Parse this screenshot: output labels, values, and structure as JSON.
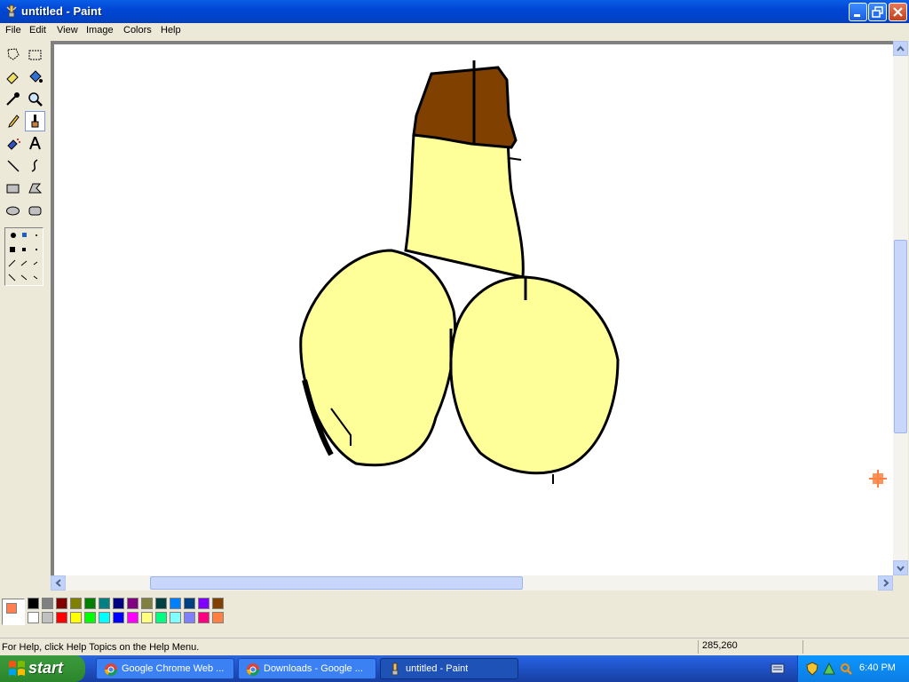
{
  "window": {
    "title": "untitled - Paint"
  },
  "menu": {
    "items": [
      "File",
      "Edit",
      "View",
      "Image",
      "Colors",
      "Help"
    ]
  },
  "toolbox": {
    "tools": [
      {
        "name": "free-form-select-icon"
      },
      {
        "name": "select-icon"
      },
      {
        "name": "eraser-icon"
      },
      {
        "name": "fill-with-color-icon"
      },
      {
        "name": "pick-color-icon"
      },
      {
        "name": "magnifier-icon"
      },
      {
        "name": "pencil-icon"
      },
      {
        "name": "brush-icon",
        "active": true
      },
      {
        "name": "airbrush-icon"
      },
      {
        "name": "text-icon"
      },
      {
        "name": "line-icon"
      },
      {
        "name": "curve-icon"
      },
      {
        "name": "rectangle-icon"
      },
      {
        "name": "polygon-icon"
      },
      {
        "name": "ellipse-icon"
      },
      {
        "name": "rounded-rectangle-icon"
      }
    ]
  },
  "colors": {
    "primary": "#ff7f50",
    "secondary": "#ffffff",
    "palette_row1": [
      "#000000",
      "#808080",
      "#800000",
      "#808000",
      "#008000",
      "#008080",
      "#000080",
      "#800080",
      "#808040",
      "#004040",
      "#0080ff",
      "#004080",
      "#8000ff",
      "#804000"
    ],
    "palette_row2": [
      "#ffffff",
      "#c0c0c0",
      "#ff0000",
      "#ffff00",
      "#00ff00",
      "#00ffff",
      "#0000ff",
      "#ff00ff",
      "#ffff80",
      "#00ff80",
      "#80ffff",
      "#8080ff",
      "#ff0080",
      "#ff8040"
    ]
  },
  "status": {
    "help_text": "For Help, click Help Topics on the Help Menu.",
    "coords": "285,260"
  },
  "taskbar": {
    "start_label": "start",
    "tasks": [
      {
        "label": "Google Chrome Web ..."
      },
      {
        "label": "Downloads - Google ..."
      },
      {
        "label": "untitled - Paint",
        "active": true
      }
    ],
    "clock": "6:40 PM"
  }
}
